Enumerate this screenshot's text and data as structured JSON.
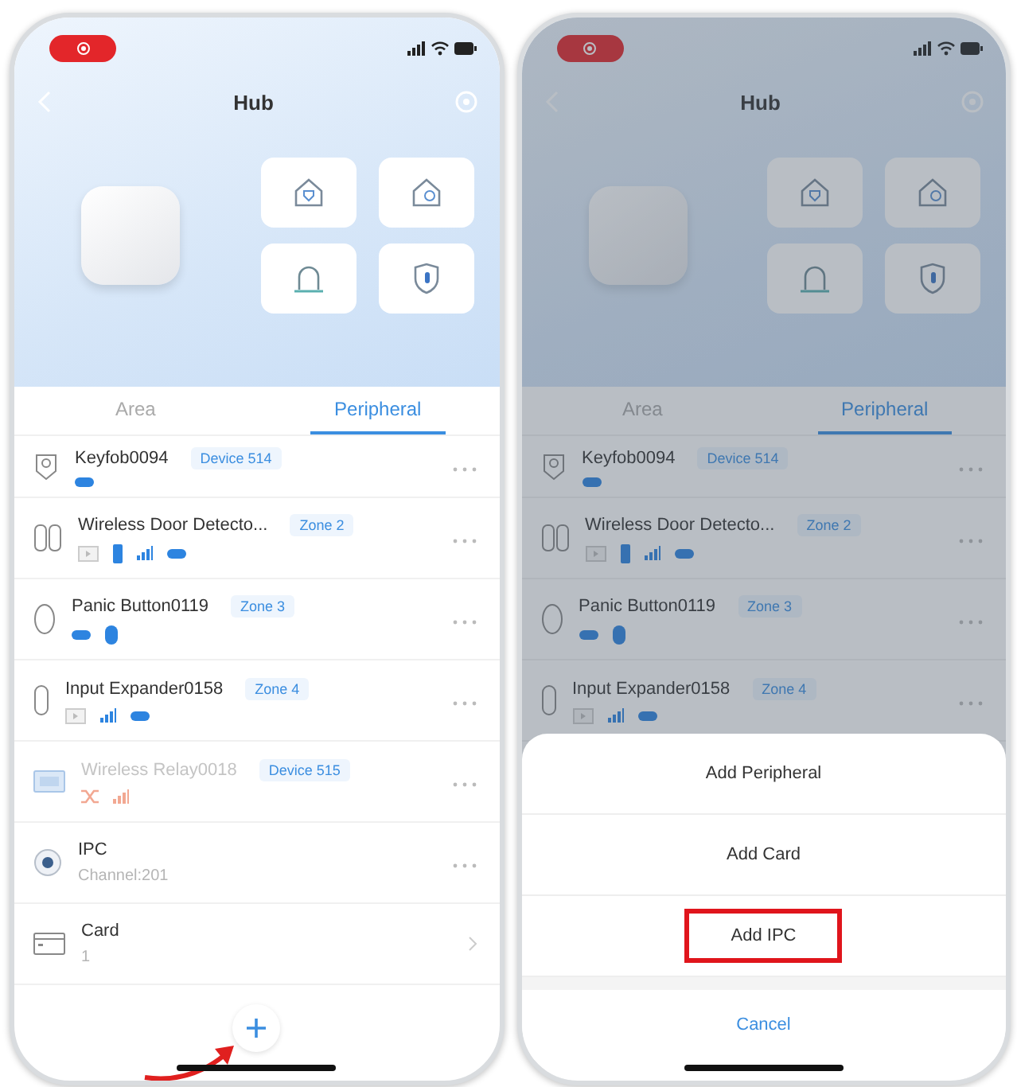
{
  "phones": [
    {
      "recording": true,
      "title": "Hub",
      "tabs": [
        {
          "label": "Area",
          "selected": false
        },
        {
          "label": "Peripheral",
          "selected": true
        }
      ],
      "rows": [
        {
          "kind": "keyfob",
          "name": "Keyfob0094",
          "tag": "Device 514",
          "disabled": false,
          "indicators": [
            {
              "kind": "battery"
            }
          ]
        },
        {
          "kind": "door",
          "name": "Wireless Door Detecto...",
          "tag": "Zone 2",
          "disabled": false,
          "indicators": [
            {
              "kind": "box"
            },
            {
              "kind": "bar"
            },
            {
              "kind": "signal"
            },
            {
              "kind": "battery"
            }
          ]
        },
        {
          "kind": "panic",
          "name": "Panic Button0119",
          "tag": "Zone 3",
          "disabled": false,
          "indicators": [
            {
              "kind": "battery"
            },
            {
              "kind": "oval"
            }
          ]
        },
        {
          "kind": "expander",
          "name": "Input Expander0158",
          "tag": "Zone 4",
          "disabled": false,
          "indicators": [
            {
              "kind": "box"
            },
            {
              "kind": "signal"
            },
            {
              "kind": "battery"
            }
          ]
        },
        {
          "kind": "relay",
          "name": "Wireless Relay0018",
          "tag": "Device 515",
          "disabled": true,
          "indicators": [
            {
              "kind": "shuffle"
            },
            {
              "kind": "signal"
            }
          ]
        },
        {
          "kind": "ipc",
          "name": "IPC",
          "subtitle": "Channel:201"
        },
        {
          "kind": "card",
          "name": "Card",
          "subtitle": "1"
        }
      ],
      "add_button": {
        "pointer_arrow": true
      }
    },
    {
      "recording": true,
      "title": "Hub",
      "tabs": [
        {
          "label": "Area",
          "selected": false
        },
        {
          "label": "Peripheral",
          "selected": true
        }
      ],
      "rows": [
        {
          "kind": "keyfob",
          "name": "Keyfob0094",
          "tag": "Device 514",
          "disabled": false,
          "indicators": [
            {
              "kind": "battery"
            }
          ]
        },
        {
          "kind": "door",
          "name": "Wireless Door Detecto...",
          "tag": "Zone 2",
          "disabled": false,
          "indicators": [
            {
              "kind": "box"
            },
            {
              "kind": "bar"
            },
            {
              "kind": "signal"
            },
            {
              "kind": "battery"
            }
          ]
        },
        {
          "kind": "panic",
          "name": "Panic Button0119",
          "tag": "Zone 3",
          "disabled": false,
          "indicators": [
            {
              "kind": "battery"
            },
            {
              "kind": "oval"
            }
          ]
        },
        {
          "kind": "expander",
          "name": "Input Expander0158",
          "tag": "Zone 4",
          "disabled": false,
          "indicators": [
            {
              "kind": "box"
            },
            {
              "kind": "signal"
            },
            {
              "kind": "battery"
            }
          ]
        }
      ],
      "action_sheet": {
        "options": [
          {
            "label": "Add Peripheral",
            "highlighted": false
          },
          {
            "label": "Add Card",
            "highlighted": false
          },
          {
            "label": "Add IPC",
            "highlighted": true
          }
        ],
        "cancel": "Cancel"
      }
    }
  ]
}
